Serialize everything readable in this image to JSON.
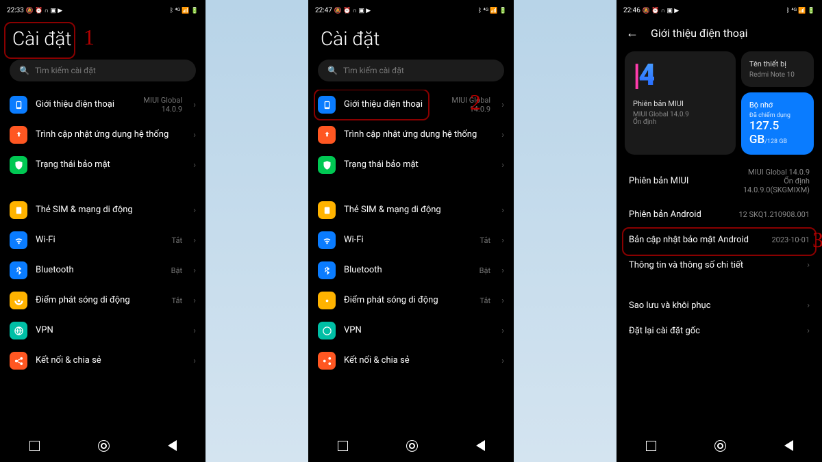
{
  "phones": {
    "p1": {
      "time": "22:33",
      "title": "Cài đặt",
      "search_placeholder": "Tìm kiếm cài đặt",
      "about": {
        "label": "Giới thiệu điện thoại",
        "value": "MIUI Global\n14.0.9"
      },
      "updater": {
        "label": "Trình cập nhật ứng dụng hệ thống"
      },
      "security": {
        "label": "Trạng thái bảo mật"
      },
      "sim": {
        "label": "Thẻ SIM & mạng di động"
      },
      "wifi": {
        "label": "Wi-Fi",
        "value": "Tắt"
      },
      "bt": {
        "label": "Bluetooth",
        "value": "Bật"
      },
      "hotspot": {
        "label": "Điểm phát sóng di động",
        "value": "Tắt"
      },
      "vpn": {
        "label": "VPN"
      },
      "conn": {
        "label": "Kết nối & chia sẻ"
      },
      "annotation": "1"
    },
    "p2": {
      "time": "22:47",
      "title": "Cài đặt",
      "search_placeholder": "Tìm kiếm cài đặt",
      "annotation": "2"
    },
    "p3": {
      "time": "22:46",
      "title": "Giới thiệu điện thoại",
      "miui_label": "Phiên bản MIUI",
      "miui_ver": "MIUI Global 14.0.9",
      "miui_stable": "Ổn định",
      "devname_label": "Tên thiết bị",
      "devname": "Redmi Note 10",
      "storage_label": "Bộ nhớ",
      "storage_sub": "Đã chiếm dụng",
      "storage_used": "127.5 GB",
      "storage_total": "/128 GB",
      "row_miui": {
        "label": "Phiên bản MIUI",
        "value": "MIUI Global 14.0.9\nỔn định\n14.0.9.0(SKGMIXM)"
      },
      "row_android": {
        "label": "Phiên bản Android",
        "value": "12 SKQ1.210908.001"
      },
      "row_security": {
        "label": "Bản cập nhật bảo mật Android",
        "value": "2023-10-01"
      },
      "row_details": {
        "label": "Thông tin và thông số chi tiết"
      },
      "row_backup": {
        "label": "Sao lưu và khôi phục"
      },
      "row_reset": {
        "label": "Đặt lại cài đặt gốc"
      },
      "annotation": "3"
    }
  },
  "status_icons": "⏰ 🔕 ⏱ ▣ ▶"
}
